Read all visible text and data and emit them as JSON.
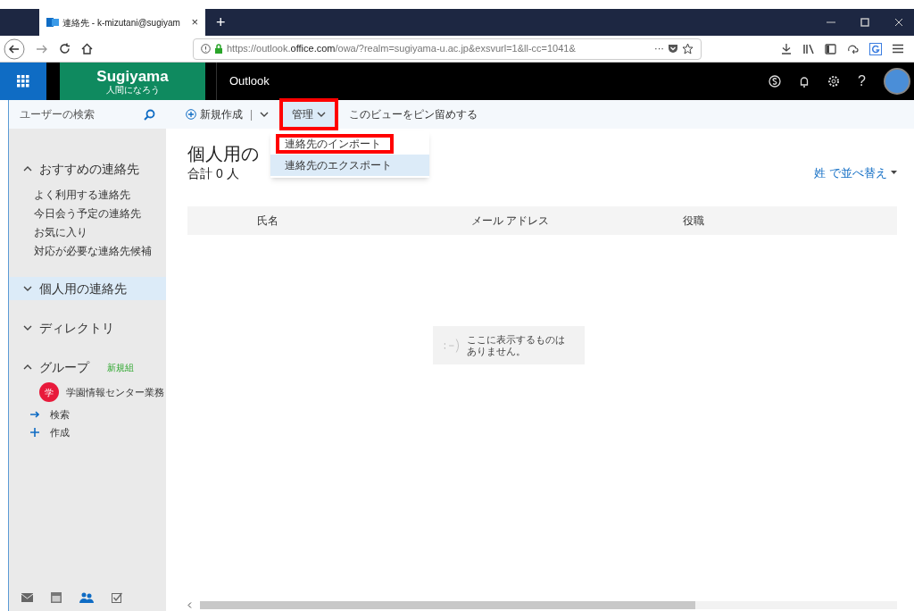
{
  "browser": {
    "tab": {
      "title": "連絡先 - k-mizutani@sugiyam",
      "close": "×"
    },
    "new_tab": "+",
    "url": "https://outlook.**office.com**/owa/?realm=sugiyama-u.ac.jp&exsvurl=1&ll-cc=1041&",
    "url_more": "···"
  },
  "header": {
    "logo": "Sugiyama",
    "tagline": "人間になろう",
    "app": "Outlook",
    "help": "?"
  },
  "sidebar": {
    "search_placeholder": "ユーザーの検索",
    "sections": [
      {
        "label": "おすすめの連絡先",
        "expanded": true,
        "selected": false,
        "items": [
          "よく利用する連絡先",
          "今日会う予定の連絡先",
          "お気に入り",
          "対応が必要な連絡先候補"
        ]
      },
      {
        "label": "個人用の連絡先",
        "expanded": false,
        "selected": true
      },
      {
        "label": "ディレクトリ",
        "expanded": false,
        "selected": false
      },
      {
        "label": "グループ",
        "expanded": true,
        "selected": false,
        "badge": "新規組",
        "groups": [
          {
            "initial": "学",
            "name": "学園情報センター業務",
            "color": "#e81a3b"
          }
        ]
      }
    ],
    "actions": [
      {
        "kind": "arrow",
        "label": "検索"
      },
      {
        "kind": "plus",
        "label": "作成"
      }
    ]
  },
  "commands": {
    "new": "新規作成",
    "separator": "|",
    "manage": {
      "label": "管理",
      "highlighted": true
    },
    "pin": "このビューをピン留めする"
  },
  "menu": [
    {
      "label": "連絡先のインポート",
      "selected": false,
      "highlighted": true
    },
    {
      "label": "連絡先のエクスポート",
      "selected": true,
      "highlighted": false
    }
  ],
  "content": {
    "title": "個人用の",
    "count": "合計 0 人",
    "sort": "姓 で並べ替え",
    "columns": [
      "氏名",
      "メール アドレス",
      "役職"
    ],
    "empty": "ここに表示するものはありません。"
  }
}
